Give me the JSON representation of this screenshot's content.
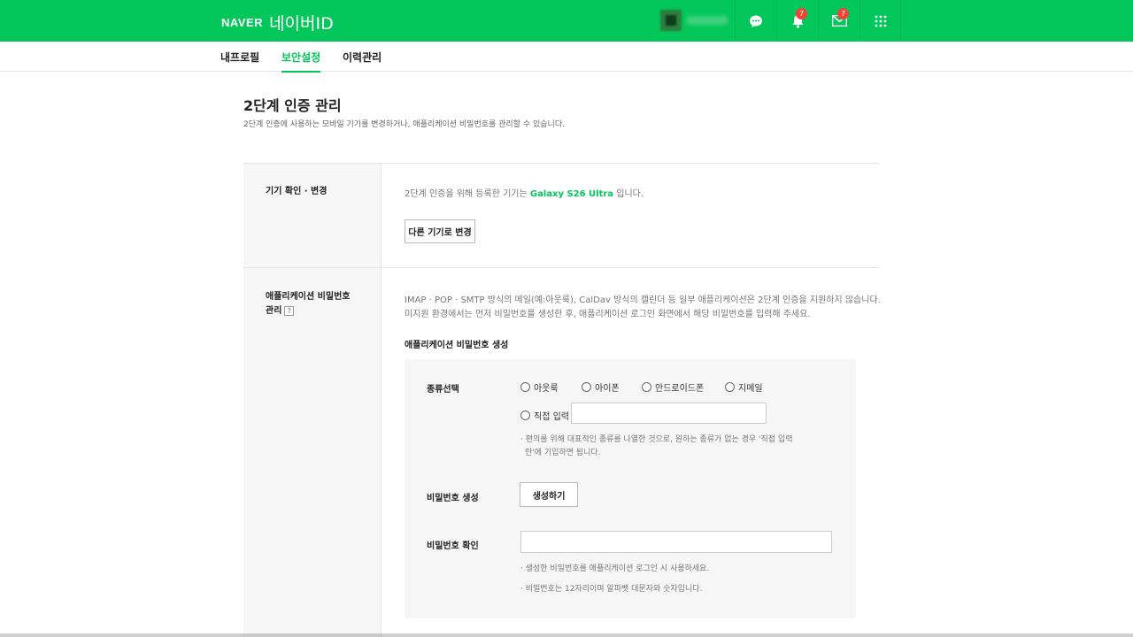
{
  "header": {
    "logo_brand": "NAVER",
    "logo_title": "네이버ID",
    "notification_badge": "7",
    "mail_badge": "7",
    "brand_color": "#03c75a"
  },
  "nav": {
    "tabs": [
      {
        "label": "내프로필"
      },
      {
        "label": "보안설정"
      },
      {
        "label": "이력관리"
      }
    ]
  },
  "page": {
    "title": "2단계 인증 관리",
    "description": "2단계 인증에 사용하는 모바일 기기를 변경하거나, 애플리케이션 비밀번호를 관리할 수 있습니다."
  },
  "device_section": {
    "label": "기기 확인 · 변경",
    "text_before": "2단계 인증을 위해 등록한 기기는 ",
    "device_name": "Galaxy S26 Ultra",
    "text_after": " 입니다.",
    "change_button": "다른 기기로 변경"
  },
  "app_password_section": {
    "label_line1": "애플리케이션 비밀번호",
    "label_line2": "관리",
    "help_icon": "?",
    "desc_line1": "IMAP · POP · SMTP 방식의 메일(예:아웃룩), CalDav 방식의 캘린더 등 일부 애플리케이션은 2단계 인증을 지원하지 않습니다.",
    "desc_line2": "미지원 환경에서는 먼저 비밀번호를 생성한 후, 애플리케이션 로그인 화면에서 해당 비밀번호를 입력해 주세요.",
    "subheading": "애플리케이션 비밀번호 생성",
    "type_label": "종류선택",
    "types": [
      "아웃룩",
      "아이폰",
      "안드로이드폰",
      "지메일"
    ],
    "custom_type": "직접 입력",
    "type_note_line1": "· 편의를 위해 대표적인 종류를 나열한 것으로, 원하는 종류가 없는 경우 '직접 입력",
    "type_note_line2": "란'에 기입하면 됩니다.",
    "generate_label": "비밀번호 생성",
    "generate_button": "생성하기",
    "confirm_label": "비밀번호 확인",
    "note1": "· 생성한 비밀번호를 애플리케이션 로그인 시 사용하세요.",
    "note2": "· 비밀번호는 12자리이며 알파벳 대문자와 숫자입니다."
  }
}
